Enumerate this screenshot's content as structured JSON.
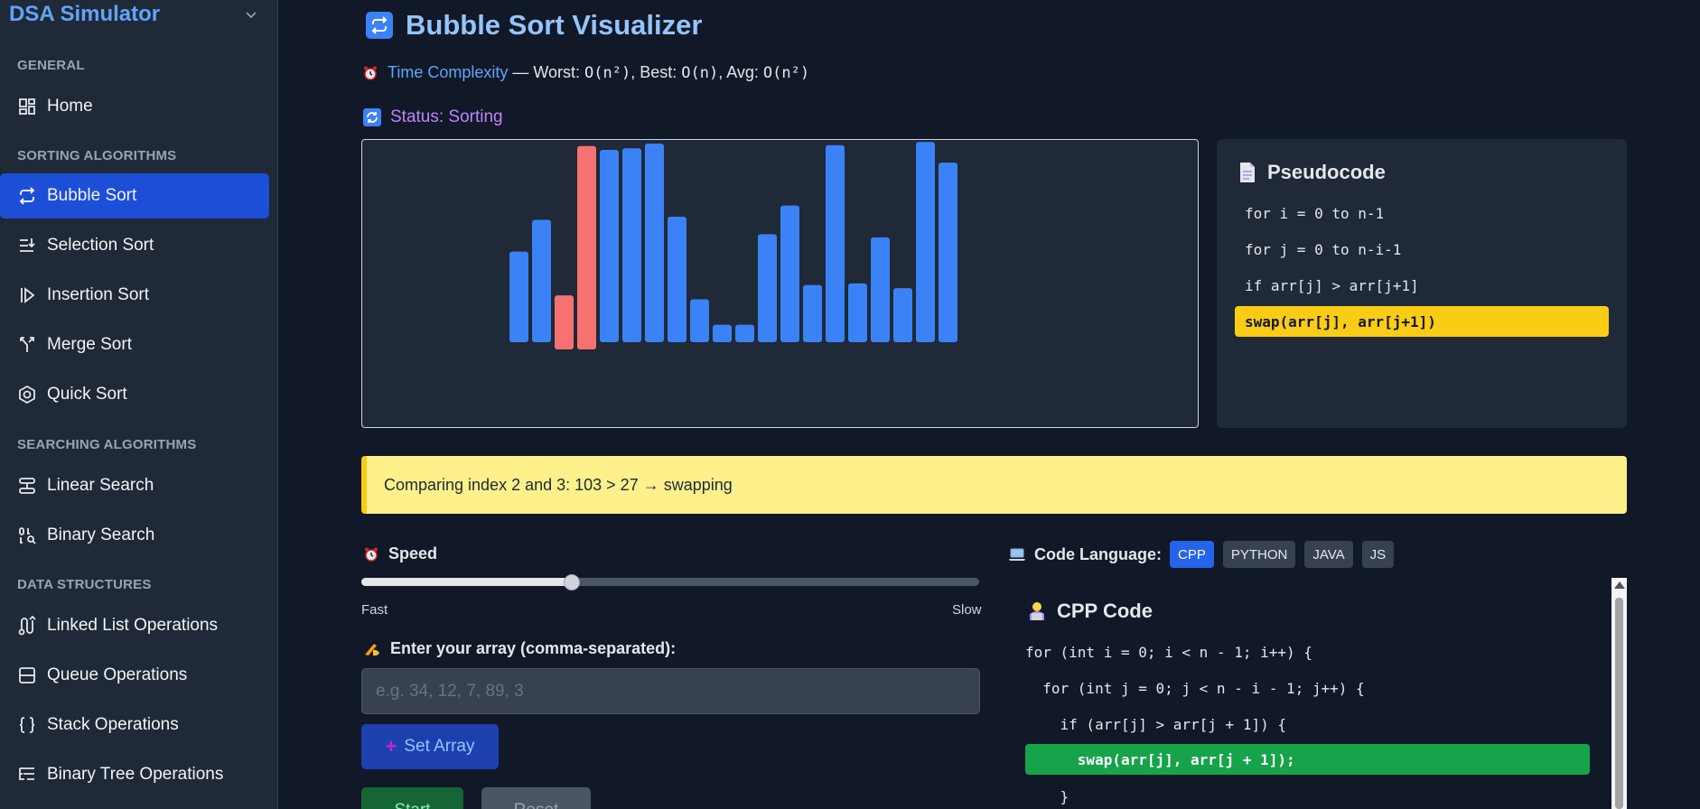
{
  "sidebar": {
    "brand": "DSA Simulator",
    "sections": [
      "GENERAL",
      "SORTING ALGORITHMS",
      "SEARCHING ALGORITHMS",
      "DATA STRUCTURES"
    ],
    "items": [
      {
        "label": "Home",
        "icon": "home-icon"
      },
      {
        "label": "Bubble Sort",
        "icon": "repeat-icon",
        "active": true
      },
      {
        "label": "Selection Sort",
        "icon": "list-sort-icon"
      },
      {
        "label": "Insertion Sort",
        "icon": "insert-icon"
      },
      {
        "label": "Merge Sort",
        "icon": "merge-icon"
      },
      {
        "label": "Quick Sort",
        "icon": "hexagon-icon"
      },
      {
        "label": "Linear Search",
        "icon": "rows-icon"
      },
      {
        "label": "Binary Search",
        "icon": "binary-search-icon"
      },
      {
        "label": "Linked List Operations",
        "icon": "linked-list-icon"
      },
      {
        "label": "Queue Operations",
        "icon": "queue-icon"
      },
      {
        "label": "Stack Operations",
        "icon": "braces-icon"
      },
      {
        "label": "Binary Tree Operations",
        "icon": "tree-icon"
      }
    ]
  },
  "main": {
    "title": "Bubble Sort Visualizer",
    "complexity": {
      "label": "Time Complexity",
      "dash": " — ",
      "worst_label": "Worst: ",
      "worst": "O(n²)",
      "best_label": ", Best: ",
      "best": "O(n)",
      "avg_label": ", Avg: ",
      "avg": "O(n²)"
    },
    "status": "Status: Sorting",
    "bars": {
      "values": [
        57,
        77,
        34,
        128,
        121,
        122,
        125,
        79,
        27,
        11,
        11,
        68,
        86,
        36,
        124,
        37,
        66,
        34,
        126,
        113
      ],
      "shift": [
        0,
        0,
        1,
        1,
        0,
        0,
        0,
        0,
        0,
        0,
        0,
        0,
        0,
        0,
        0,
        0,
        0,
        0,
        0,
        0
      ],
      "highlight": [
        2,
        3
      ],
      "bar_color": "#3b82f6",
      "highlight_color": "#f87171"
    },
    "pseudocode": {
      "title": "Pseudocode",
      "lines": [
        "for i = 0 to n-1",
        "for j = 0 to n-i-1",
        "if arr[j] > arr[j+1]",
        "swap(arr[j], arr[j+1])"
      ],
      "active_line": 3
    },
    "message": "Comparing index 2 and 3: 103 > 27 → swapping",
    "speed": {
      "label": "Speed",
      "fast": "Fast",
      "slow": "Slow",
      "value": 0.34
    },
    "array_input": {
      "label": "Enter your array (comma-separated):",
      "placeholder": "e.g. 34, 12, 7, 89, 3",
      "value": ""
    },
    "buttons": {
      "set": "Set Array",
      "start": "Start",
      "reset": "Reset"
    },
    "code": {
      "language_label": "Code Language:",
      "languages": [
        "CPP",
        "PYTHON",
        "JAVA",
        "JS"
      ],
      "active_language": "CPP",
      "title": "CPP Code",
      "lines": [
        "for (int i = 0; i < n - 1; i++) {",
        "  for (int j = 0; j < n - i - 1; j++) {",
        "    if (arr[j] > arr[j + 1]) {",
        "      swap(arr[j], arr[j + 1]);",
        "    }"
      ],
      "active_line": 3
    }
  },
  "colors": {
    "accent": "#1d4ed8",
    "bar": "#3b82f6",
    "compare": "#f87171",
    "pseudo_highlight": "#facc15",
    "code_highlight": "#16a34a",
    "message_bg": "#fef08a"
  }
}
